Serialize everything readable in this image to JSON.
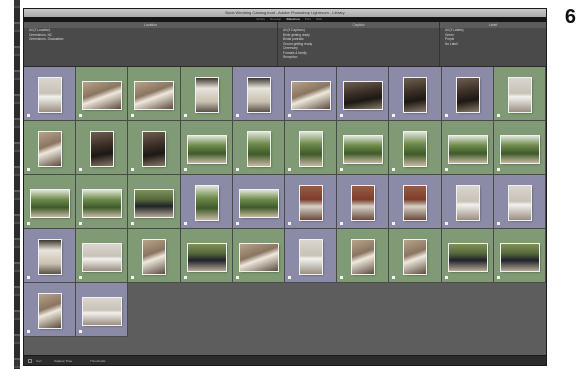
{
  "page": {
    "number": "6"
  },
  "window": {
    "title": "Book Wedding Catalog.lrcat - Adobe Photoshop Lightroom - Library"
  },
  "modules": [
    "Library",
    "Develop",
    "Slideshow",
    "Print",
    "Web"
  ],
  "active_module": 2,
  "filter_columns": [
    {
      "header": "Location",
      "rows": [
        {
          "label": "All (3 Location)",
          "count": "",
          "selected": false
        },
        {
          "label": "Greensboro, NC",
          "count": "",
          "selected": false
        },
        {
          "label": "Greensboro, Graduation",
          "count": "",
          "selected": false
        }
      ]
    },
    {
      "header": "Caption",
      "rows": [
        {
          "label": "All (5 Captions)",
          "count": "",
          "selected": false
        },
        {
          "label": "Bride getting ready",
          "count": "",
          "selected": false
        },
        {
          "label": "Bridal portraits",
          "count": "",
          "selected": false
        },
        {
          "label": "Groom getting ready",
          "count": "",
          "selected": false
        },
        {
          "label": "Ceremony",
          "count": "",
          "selected": false
        },
        {
          "label": "Formals & family",
          "count": "",
          "selected": false
        },
        {
          "label": "Reception",
          "count": "",
          "selected": false
        }
      ]
    },
    {
      "header": "Label",
      "rows": [
        {
          "label": "All (3 Labels)",
          "count": "",
          "selected": false
        },
        {
          "label": "Green",
          "count": "",
          "selected": false
        },
        {
          "label": "Purple",
          "count": "",
          "selected": false
        },
        {
          "label": "No Label",
          "count": "",
          "selected": false
        }
      ]
    }
  ],
  "toolbar": {
    "sort_label": "Sort:",
    "sort_value": "Capture Time",
    "thumbnails_label": "Thumbnails"
  },
  "label_colors": {
    "green": "#7f9a74",
    "purple": "#8b8ba8",
    "plain": "#5d5d5d"
  },
  "thumbnails": [
    {
      "label": "purple",
      "orient": "p",
      "scene": "white"
    },
    {
      "label": "green",
      "orient": "l",
      "scene": "warm"
    },
    {
      "label": "green",
      "orient": "l",
      "scene": "warm"
    },
    {
      "label": "green",
      "orient": "p",
      "scene": "window"
    },
    {
      "label": "purple",
      "orient": "p",
      "scene": "window"
    },
    {
      "label": "purple",
      "orient": "l",
      "scene": "warm"
    },
    {
      "label": "purple",
      "orient": "l",
      "scene": "dark"
    },
    {
      "label": "purple",
      "orient": "p",
      "scene": "dark"
    },
    {
      "label": "purple",
      "orient": "p",
      "scene": "dark"
    },
    {
      "label": "green",
      "orient": "p",
      "scene": "white"
    },
    {
      "label": "green",
      "orient": "p",
      "scene": "warm"
    },
    {
      "label": "green",
      "orient": "p",
      "scene": "dark"
    },
    {
      "label": "green",
      "orient": "p",
      "scene": "dark"
    },
    {
      "label": "green",
      "orient": "l",
      "scene": "trees"
    },
    {
      "label": "green",
      "orient": "p",
      "scene": "trees"
    },
    {
      "label": "green",
      "orient": "p",
      "scene": "trees"
    },
    {
      "label": "green",
      "orient": "l",
      "scene": "trees"
    },
    {
      "label": "green",
      "orient": "p",
      "scene": "trees"
    },
    {
      "label": "green",
      "orient": "l",
      "scene": "trees"
    },
    {
      "label": "green",
      "orient": "l",
      "scene": "trees"
    },
    {
      "label": "green",
      "orient": "l",
      "scene": "trees"
    },
    {
      "label": "green",
      "orient": "l",
      "scene": "trees"
    },
    {
      "label": "green",
      "orient": "l",
      "scene": "group"
    },
    {
      "label": "purple",
      "orient": "p",
      "scene": "trees"
    },
    {
      "label": "purple",
      "orient": "l",
      "scene": "trees"
    },
    {
      "label": "purple",
      "orient": "p",
      "scene": "brick"
    },
    {
      "label": "purple",
      "orient": "p",
      "scene": "brick"
    },
    {
      "label": "purple",
      "orient": "p",
      "scene": "brick"
    },
    {
      "label": "purple",
      "orient": "p",
      "scene": "white"
    },
    {
      "label": "purple",
      "orient": "p",
      "scene": "white"
    },
    {
      "label": "purple",
      "orient": "p",
      "scene": "window"
    },
    {
      "label": "green",
      "orient": "l",
      "scene": "white"
    },
    {
      "label": "green",
      "orient": "p",
      "scene": "warm"
    },
    {
      "label": "green",
      "orient": "l",
      "scene": "group"
    },
    {
      "label": "green",
      "orient": "l",
      "scene": "warm"
    },
    {
      "label": "purple",
      "orient": "p",
      "scene": "white"
    },
    {
      "label": "green",
      "orient": "p",
      "scene": "warm"
    },
    {
      "label": "green",
      "orient": "p",
      "scene": "warm"
    },
    {
      "label": "green",
      "orient": "l",
      "scene": "group"
    },
    {
      "label": "green",
      "orient": "l",
      "scene": "group"
    },
    {
      "label": "purple",
      "orient": "p",
      "scene": "warm"
    },
    {
      "label": "purple",
      "orient": "l",
      "scene": "white"
    }
  ]
}
